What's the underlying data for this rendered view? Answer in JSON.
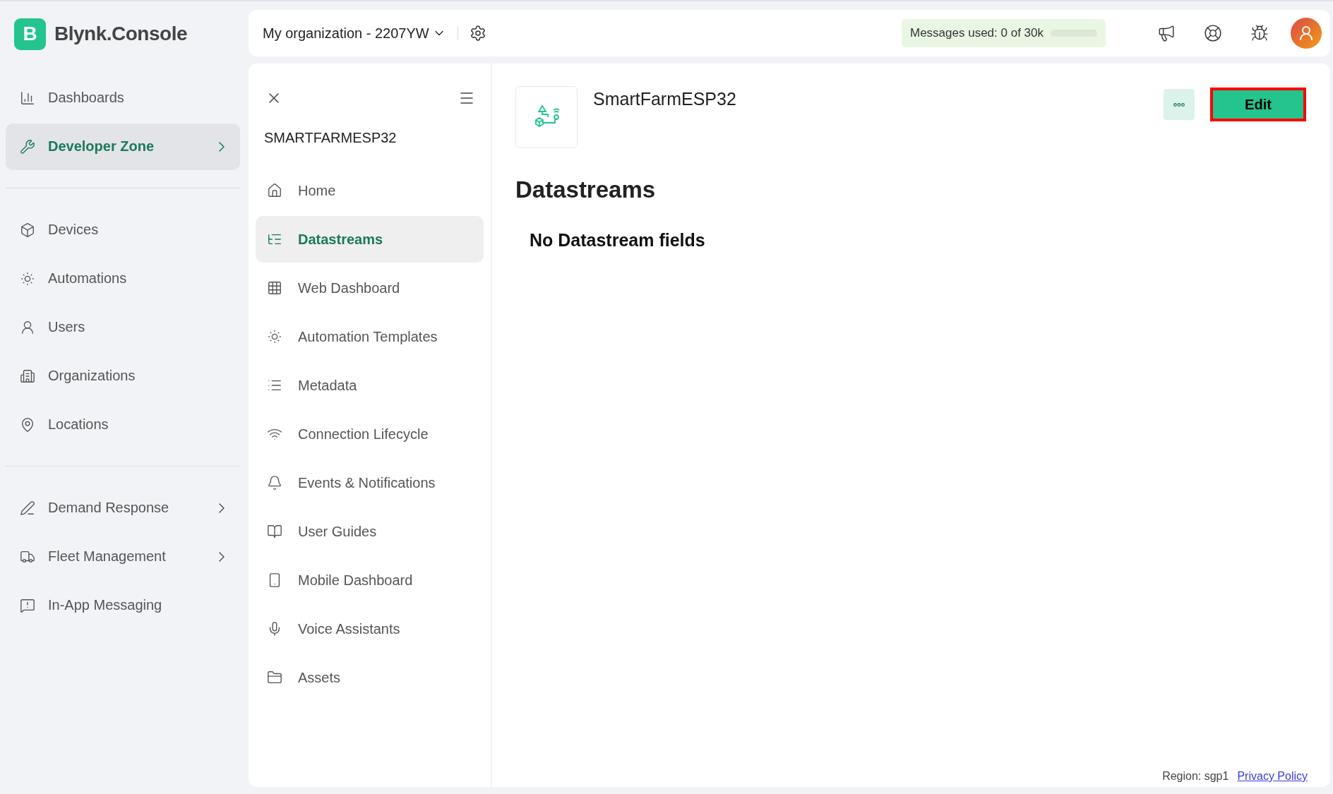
{
  "brand": {
    "logo_letter": "B",
    "name": "Blynk.Console"
  },
  "sidebar": {
    "sections": [
      {
        "items": [
          {
            "label": "Dashboards",
            "selected": false,
            "submenu": false
          },
          {
            "label": "Developer Zone",
            "selected": true,
            "submenu": true
          }
        ]
      },
      {
        "items": [
          {
            "label": "Devices",
            "selected": false,
            "submenu": false
          },
          {
            "label": "Automations",
            "selected": false,
            "submenu": false
          },
          {
            "label": "Users",
            "selected": false,
            "submenu": false
          },
          {
            "label": "Organizations",
            "selected": false,
            "submenu": false
          },
          {
            "label": "Locations",
            "selected": false,
            "submenu": false
          }
        ]
      },
      {
        "items": [
          {
            "label": "Demand Response",
            "selected": false,
            "submenu": true
          },
          {
            "label": "Fleet Management",
            "selected": false,
            "submenu": true
          },
          {
            "label": "In-App Messaging",
            "selected": false,
            "submenu": false
          }
        ]
      }
    ]
  },
  "topbar": {
    "organization": "My organization - 2207YW",
    "messages": {
      "label": "Messages used:",
      "value": "0 of 30k",
      "level": 0
    }
  },
  "template_nav": {
    "title": "SMARTFARMESP32",
    "items": [
      {
        "label": "Home",
        "selected": false
      },
      {
        "label": "Datastreams",
        "selected": true
      },
      {
        "label": "Web Dashboard",
        "selected": false
      },
      {
        "label": "Automation Templates",
        "selected": false
      },
      {
        "label": "Metadata",
        "selected": false
      },
      {
        "label": "Connection Lifecycle",
        "selected": false
      },
      {
        "label": "Events & Notifications",
        "selected": false
      },
      {
        "label": "User Guides",
        "selected": false
      },
      {
        "label": "Mobile Dashboard",
        "selected": false
      },
      {
        "label": "Voice Assistants",
        "selected": false
      },
      {
        "label": "Assets",
        "selected": false
      }
    ]
  },
  "template": {
    "name": "SmartFarmESP32",
    "edit_button": "Edit",
    "section_title": "Datastreams",
    "empty_message": "No Datastream fields"
  },
  "footer": {
    "region": "Region: sgp1",
    "privacy_link": "Privacy Policy"
  }
}
